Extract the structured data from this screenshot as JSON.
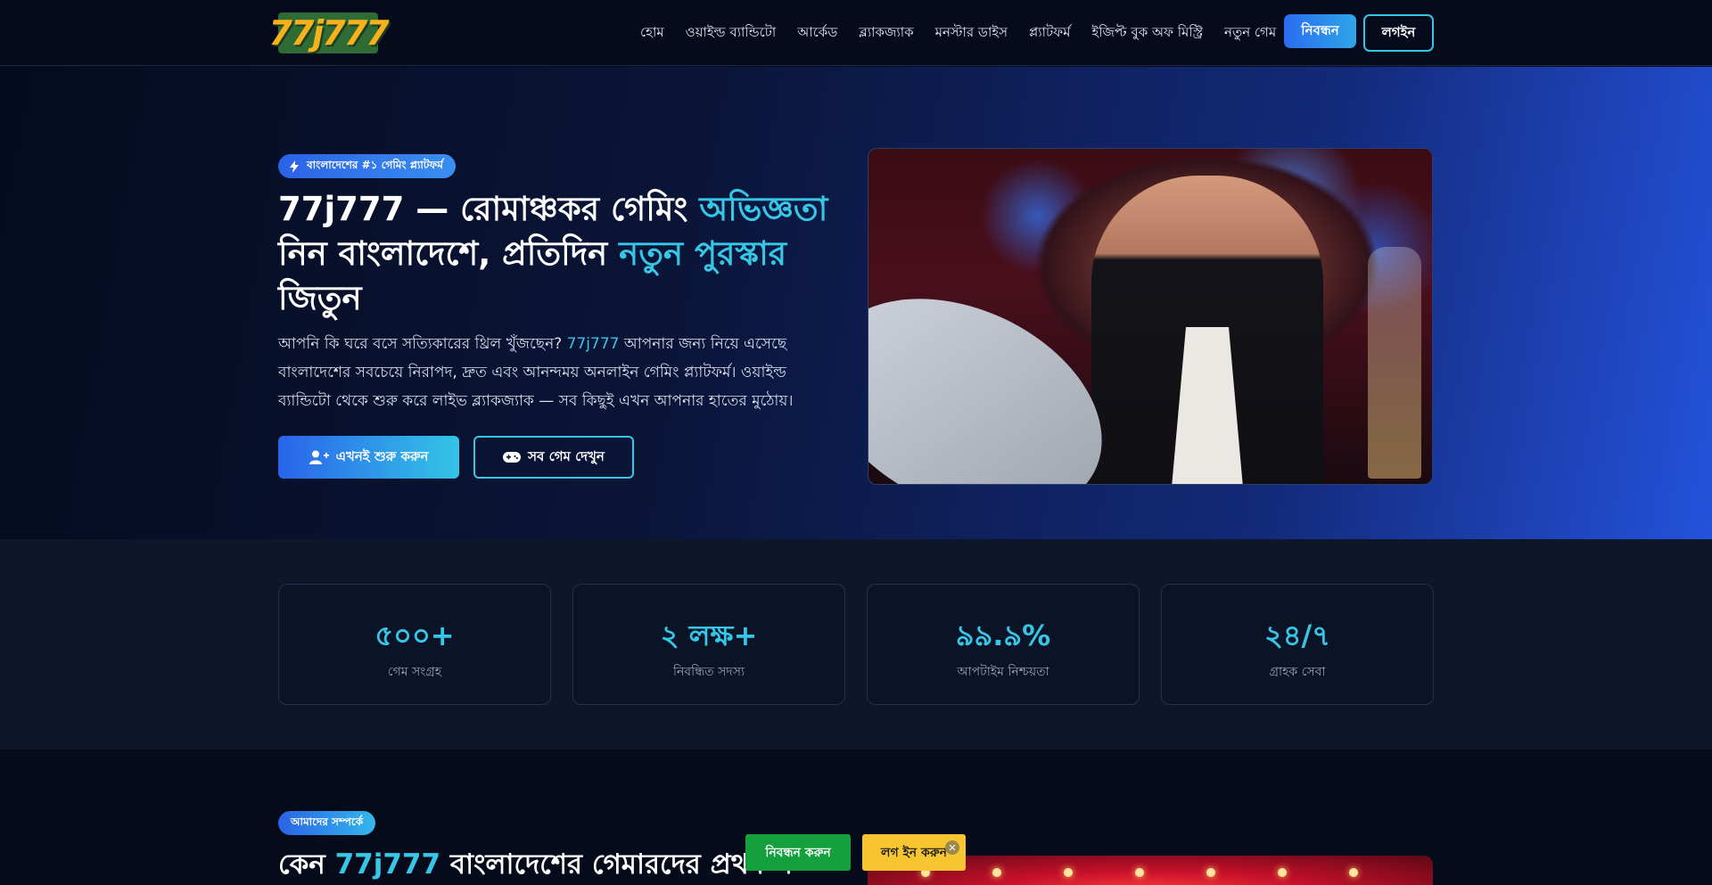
{
  "header": {
    "logo_text": "77j777",
    "nav": [
      "হোম",
      "ওয়াইল্ড ব্যান্ডিটো",
      "আর্কেড",
      "ব্ল্যাকজ্যাক",
      "মনস্টার ডাইস",
      "প্ল্যাটফর্ম",
      "ইজিপ্ট বুক অফ মিস্ট্রি",
      "নতুন গেম"
    ],
    "register_label": "নিবন্ধন",
    "login_label": "লগইন"
  },
  "hero": {
    "badge": "বাংলাদেশের #১ গেমিং প্ল্যাটফর্ম",
    "title_part1": "77j777 — রোমাঞ্চকর গেমিং ",
    "title_hl1": "অভিজ্ঞতা",
    "title_part2": " নিন বাংলাদেশে, প্রতিদিন ",
    "title_hl2": "নতুন পুরস্কার",
    "title_part3": " জিতুন",
    "desc_part1": "আপনি কি ঘরে বসে সত্যিকারের থ্রিল খুঁজছেন? ",
    "desc_hl": "77j777",
    "desc_part2": " আপনার জন্য নিয়ে এসেছে বাংলাদেশের সবচেয়ে নিরাপদ, দ্রুত এবং আনন্দময় অনলাইন গেমিং প্ল্যাটফর্ম। ওয়াইল্ড ব্যান্ডিটো থেকে শুরু করে লাইভ ব্ল্যাকজ্যাক — সব কিছুই এখন আপনার হাতের মুঠোয়।",
    "start_label": "এখনই শুরু করুন",
    "games_label": "সব গেম দেখুন"
  },
  "stats": [
    {
      "value": "৫০০+",
      "label": "গেম সংগ্রহ"
    },
    {
      "value": "২ লক্ষ+",
      "label": "নিবন্ধিত সদস্য"
    },
    {
      "value": "৯৯.৯%",
      "label": "আপটাইম নিশ্চয়তা"
    },
    {
      "value": "২৪/৭",
      "label": "গ্রাহক সেবা"
    }
  ],
  "about": {
    "badge": "আমাদের সম্পর্কে",
    "title_part1": "কেন ",
    "title_hl": "77j777",
    "title_part2": " বাংলাদেশের গেমারদের প্রথম প"
  },
  "sticky": {
    "register_label": "নিবন্ধন করুন",
    "login_label": "লগ ইন করুন",
    "close": "✕"
  },
  "colors": {
    "accent": "#36c6e6",
    "primary": "#2a63eb",
    "sticky_register": "#14a03d",
    "sticky_login": "#f6c530"
  }
}
